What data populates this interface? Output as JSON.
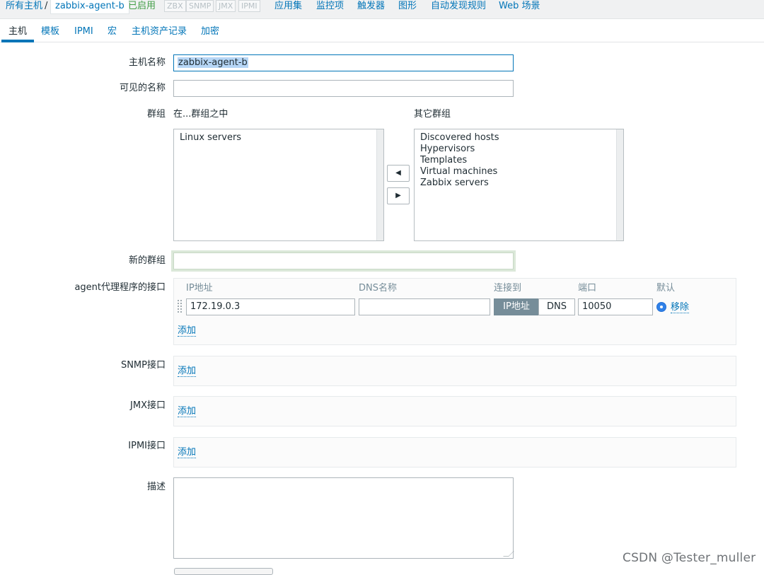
{
  "breadcrumb": {
    "all_hosts": "所有主机",
    "separator": "/",
    "host": "zabbix-agent-b",
    "status": "已启用",
    "protocols": [
      "ZBX",
      "SNMP",
      "JMX",
      "IPMI"
    ],
    "nav": [
      "应用集",
      "监控项",
      "触发器",
      "图形",
      "自动发现规则",
      "Web 场景"
    ]
  },
  "tabs": [
    "主机",
    "模板",
    "IPMI",
    "宏",
    "主机资产记录",
    "加密"
  ],
  "form": {
    "host_name_label": "主机名称",
    "host_name_value": "zabbix-agent-b",
    "visible_name_label": "可见的名称",
    "visible_name_value": "",
    "groups_label": "群组",
    "in_groups_label": "在...群组之中",
    "other_groups_label": "其它群组",
    "in_groups": [
      "Linux servers"
    ],
    "other_groups": [
      "Discovered hosts",
      "Hypervisors",
      "Templates",
      "Virtual machines",
      "Zabbix servers"
    ],
    "move_left_glyph": "◀",
    "move_right_glyph": "▶",
    "new_group_label": "新的群组",
    "new_group_value": "",
    "agent_label": "agent代理程序的接口",
    "agent_columns": {
      "ip": "IP地址",
      "dns": "DNS名称",
      "connect": "连接到",
      "port": "端口",
      "default": "默认"
    },
    "agent_row": {
      "ip": "172.19.0.3",
      "dns": "",
      "connect_ip": "IP地址",
      "connect_dns": "DNS",
      "port": "10050",
      "remove": "移除"
    },
    "add": "添加",
    "snmp_label": "SNMP接口",
    "jmx_label": "JMX接口",
    "ipmi_label": "IPMI接口",
    "description_label": "描述",
    "description_value": ""
  },
  "watermark": "CSDN @Tester_muller",
  "colors": {
    "link": "#0275b8",
    "enabled": "#429e47",
    "selected_segment": "#768d99",
    "radio": "#3081e8"
  }
}
